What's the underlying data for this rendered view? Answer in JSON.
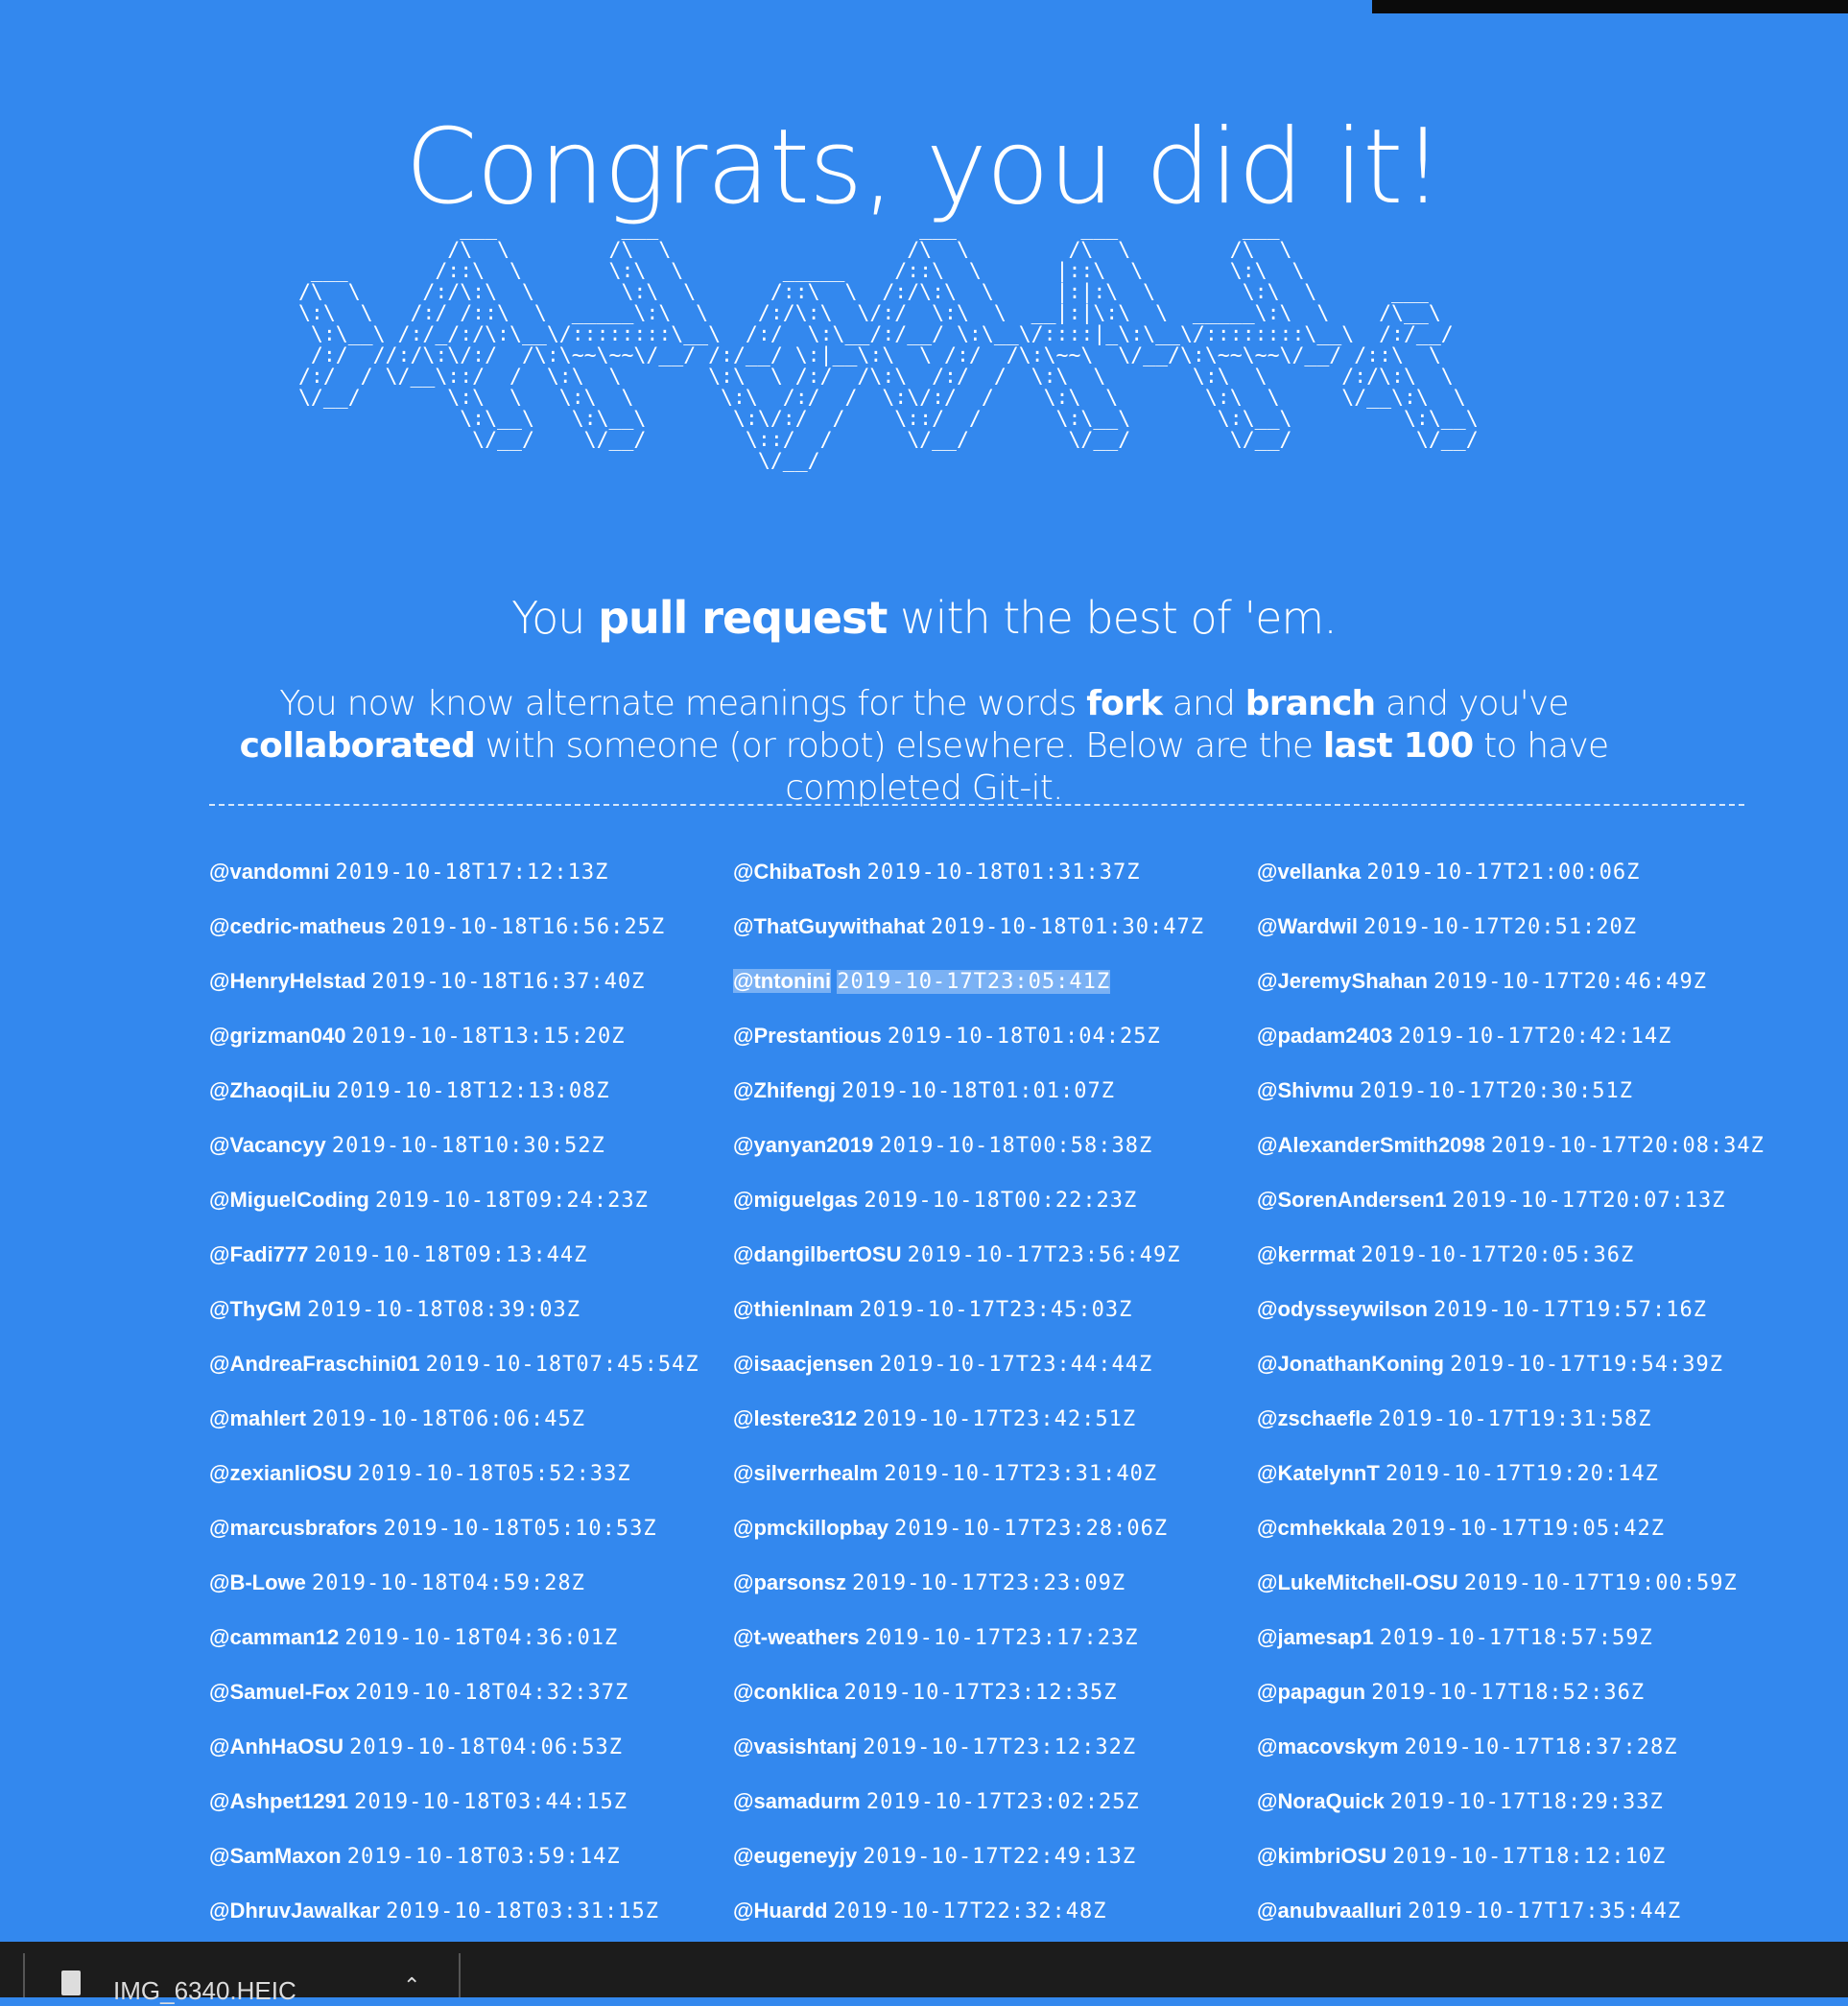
{
  "colors": {
    "background": "#3388ee"
  },
  "title": "Congrats, you did it!",
  "ascii_art": "              ___          ___                     ___          ___          ___\n             /\\  \\        /\\  \\                   /\\  \\        /\\  \\        /\\  \\\n  ___       /::\\  \\       \\:\\  \\        _____    /::\\  \\      |::\\  \\       \\:\\  \\\n /\\  \\     /:/\\:\\  \\       \\:\\  \\      /::\\  \\  /:/\\:\\  \\     |:|:\\  \\       \\:\\  \\      ___\n \\:\\  \\   /:/ /::\\  \\  _____\\:\\  \\    /:/\\:\\  \\/:/  \\:\\  \\  __|:|\\:\\  \\  _____\\:\\  \\    /\\__\\\n  \\:\\__\\ /:/_/:/\\:\\__\\/::::::::\\__\\  /:/  \\:\\__/:/__/ \\:\\__\\/::::|_\\:\\__\\/::::::::\\__\\  /:/__/\n  /:/  //:/\\:\\/:/  /\\:\\~~\\~~\\/__/ /:/__/ \\:|__\\:\\  \\ /:/  /\\:\\~~\\  \\/__/\\:\\~~\\~~\\/__/ /::\\  \\\n /:/  / \\/__\\::/  /  \\:\\  \\       \\:\\  \\ /:/  /\\:\\  /:/  /  \\:\\  \\       \\:\\  \\      /:/\\:\\  \\\n \\/__/       \\:\\  \\   \\:\\  \\       \\:\\  /:/  /  \\:\\/:/  /    \\:\\  \\       \\:\\  \\     \\/__\\:\\  \\\n              \\:\\__\\   \\:\\__\\       \\:\\/:/  /    \\::/  /      \\:\\__\\       \\:\\__\\         \\:\\__\\\n               \\/__/    \\/__/        \\::/  /      \\/__/        \\/__/        \\/__/          \\/__/\n                                      \\/__/",
  "subtitle": {
    "pre": "You ",
    "bold": "pull request",
    "post": " with the best of 'em."
  },
  "description": {
    "t1": "You now know alternate meanings for the words ",
    "b1": "fork",
    "t2": " and ",
    "b2": "branch",
    "t3": " and you've ",
    "b3": "collaborated",
    "t4": " with someone (or robot) elsewhere. Below are the ",
    "b4": "last 100",
    "t5": " to have completed Git-it."
  },
  "completions": {
    "col1": [
      {
        "user": "@vandomni",
        "ts": "2019-10-18T17:12:13Z"
      },
      {
        "user": "@cedric-matheus",
        "ts": "2019-10-18T16:56:25Z"
      },
      {
        "user": "@HenryHelstad",
        "ts": "2019-10-18T16:37:40Z"
      },
      {
        "user": "@grizman040",
        "ts": "2019-10-18T13:15:20Z"
      },
      {
        "user": "@ZhaoqiLiu",
        "ts": "2019-10-18T12:13:08Z"
      },
      {
        "user": "@Vacancyy",
        "ts": "2019-10-18T10:30:52Z"
      },
      {
        "user": "@MiguelCoding",
        "ts": "2019-10-18T09:24:23Z"
      },
      {
        "user": "@Fadi777",
        "ts": "2019-10-18T09:13:44Z"
      },
      {
        "user": "@ThyGM",
        "ts": "2019-10-18T08:39:03Z"
      },
      {
        "user": "@AndreaFraschini01",
        "ts": "2019-10-18T07:45:54Z"
      },
      {
        "user": "@mahlert",
        "ts": "2019-10-18T06:06:45Z"
      },
      {
        "user": "@zexianliOSU",
        "ts": "2019-10-18T05:52:33Z"
      },
      {
        "user": "@marcusbrafors",
        "ts": "2019-10-18T05:10:53Z"
      },
      {
        "user": "@B-Lowe",
        "ts": "2019-10-18T04:59:28Z"
      },
      {
        "user": "@camman12",
        "ts": "2019-10-18T04:36:01Z"
      },
      {
        "user": "@Samuel-Fox",
        "ts": "2019-10-18T04:32:37Z"
      },
      {
        "user": "@AnhHaOSU",
        "ts": "2019-10-18T04:06:53Z"
      },
      {
        "user": "@Ashpet1291",
        "ts": "2019-10-18T03:44:15Z"
      },
      {
        "user": "@SamMaxon",
        "ts": "2019-10-18T03:59:14Z"
      },
      {
        "user": "@DhruvJawalkar",
        "ts": "2019-10-18T03:31:15Z"
      }
    ],
    "col2": [
      {
        "user": "@ChibaTosh",
        "ts": "2019-10-18T01:31:37Z"
      },
      {
        "user": "@ThatGuywithahat",
        "ts": "2019-10-18T01:30:47Z"
      },
      {
        "user": "@tntonini",
        "ts": "2019-10-17T23:05:41Z",
        "selected": true
      },
      {
        "user": "@Prestantious",
        "ts": "2019-10-18T01:04:25Z"
      },
      {
        "user": "@Zhifengj",
        "ts": "2019-10-18T01:01:07Z"
      },
      {
        "user": "@yanyan2019",
        "ts": "2019-10-18T00:58:38Z"
      },
      {
        "user": "@miguelgas",
        "ts": "2019-10-18T00:22:23Z"
      },
      {
        "user": "@dangilbertOSU",
        "ts": "2019-10-17T23:56:49Z"
      },
      {
        "user": "@thienlnam",
        "ts": "2019-10-17T23:45:03Z"
      },
      {
        "user": "@isaacjensen",
        "ts": "2019-10-17T23:44:44Z"
      },
      {
        "user": "@lestere312",
        "ts": "2019-10-17T23:42:51Z"
      },
      {
        "user": "@silverrhealm",
        "ts": "2019-10-17T23:31:40Z"
      },
      {
        "user": "@pmckillopbay",
        "ts": "2019-10-17T23:28:06Z"
      },
      {
        "user": "@parsonsz",
        "ts": "2019-10-17T23:23:09Z"
      },
      {
        "user": "@t-weathers",
        "ts": "2019-10-17T23:17:23Z"
      },
      {
        "user": "@conklica",
        "ts": "2019-10-17T23:12:35Z"
      },
      {
        "user": "@vasishtanj",
        "ts": "2019-10-17T23:12:32Z"
      },
      {
        "user": "@samadurm",
        "ts": "2019-10-17T23:02:25Z"
      },
      {
        "user": "@eugeneyjy",
        "ts": "2019-10-17T22:49:13Z"
      },
      {
        "user": "@Huardd",
        "ts": "2019-10-17T22:32:48Z"
      }
    ],
    "col3": [
      {
        "user": "@vellanka",
        "ts": "2019-10-17T21:00:06Z"
      },
      {
        "user": "@Wardwil",
        "ts": "2019-10-17T20:51:20Z"
      },
      {
        "user": "@JeremyShahan",
        "ts": "2019-10-17T20:46:49Z"
      },
      {
        "user": "@padam2403",
        "ts": "2019-10-17T20:42:14Z"
      },
      {
        "user": "@Shivmu",
        "ts": "2019-10-17T20:30:51Z"
      },
      {
        "user": "@AlexanderSmith2098",
        "ts": "2019-10-17T20:08:34Z"
      },
      {
        "user": "@SorenAndersen1",
        "ts": "2019-10-17T20:07:13Z"
      },
      {
        "user": "@kerrmat",
        "ts": "2019-10-17T20:05:36Z"
      },
      {
        "user": "@odysseywilson",
        "ts": "2019-10-17T19:57:16Z"
      },
      {
        "user": "@JonathanKoning",
        "ts": "2019-10-17T19:54:39Z"
      },
      {
        "user": "@zschaefle",
        "ts": "2019-10-17T19:31:58Z"
      },
      {
        "user": "@KatelynnT",
        "ts": "2019-10-17T19:20:14Z"
      },
      {
        "user": "@cmhekkala",
        "ts": "2019-10-17T19:05:42Z"
      },
      {
        "user": "@LukeMitchell-OSU",
        "ts": "2019-10-17T19:00:59Z"
      },
      {
        "user": "@jamesap1",
        "ts": "2019-10-17T18:57:59Z"
      },
      {
        "user": "@papagun",
        "ts": "2019-10-17T18:52:36Z"
      },
      {
        "user": "@macovskym",
        "ts": "2019-10-17T18:37:28Z"
      },
      {
        "user": "@NoraQuick",
        "ts": "2019-10-17T18:29:33Z"
      },
      {
        "user": "@kimbriOSU",
        "ts": "2019-10-17T18:12:10Z"
      },
      {
        "user": "@anubvaalluri",
        "ts": "2019-10-17T17:35:44Z"
      }
    ]
  },
  "download_bar": {
    "file_name": "IMG_6340.HEIC",
    "file_icon": "document-icon",
    "menu_icon": "chevron-up-icon"
  }
}
